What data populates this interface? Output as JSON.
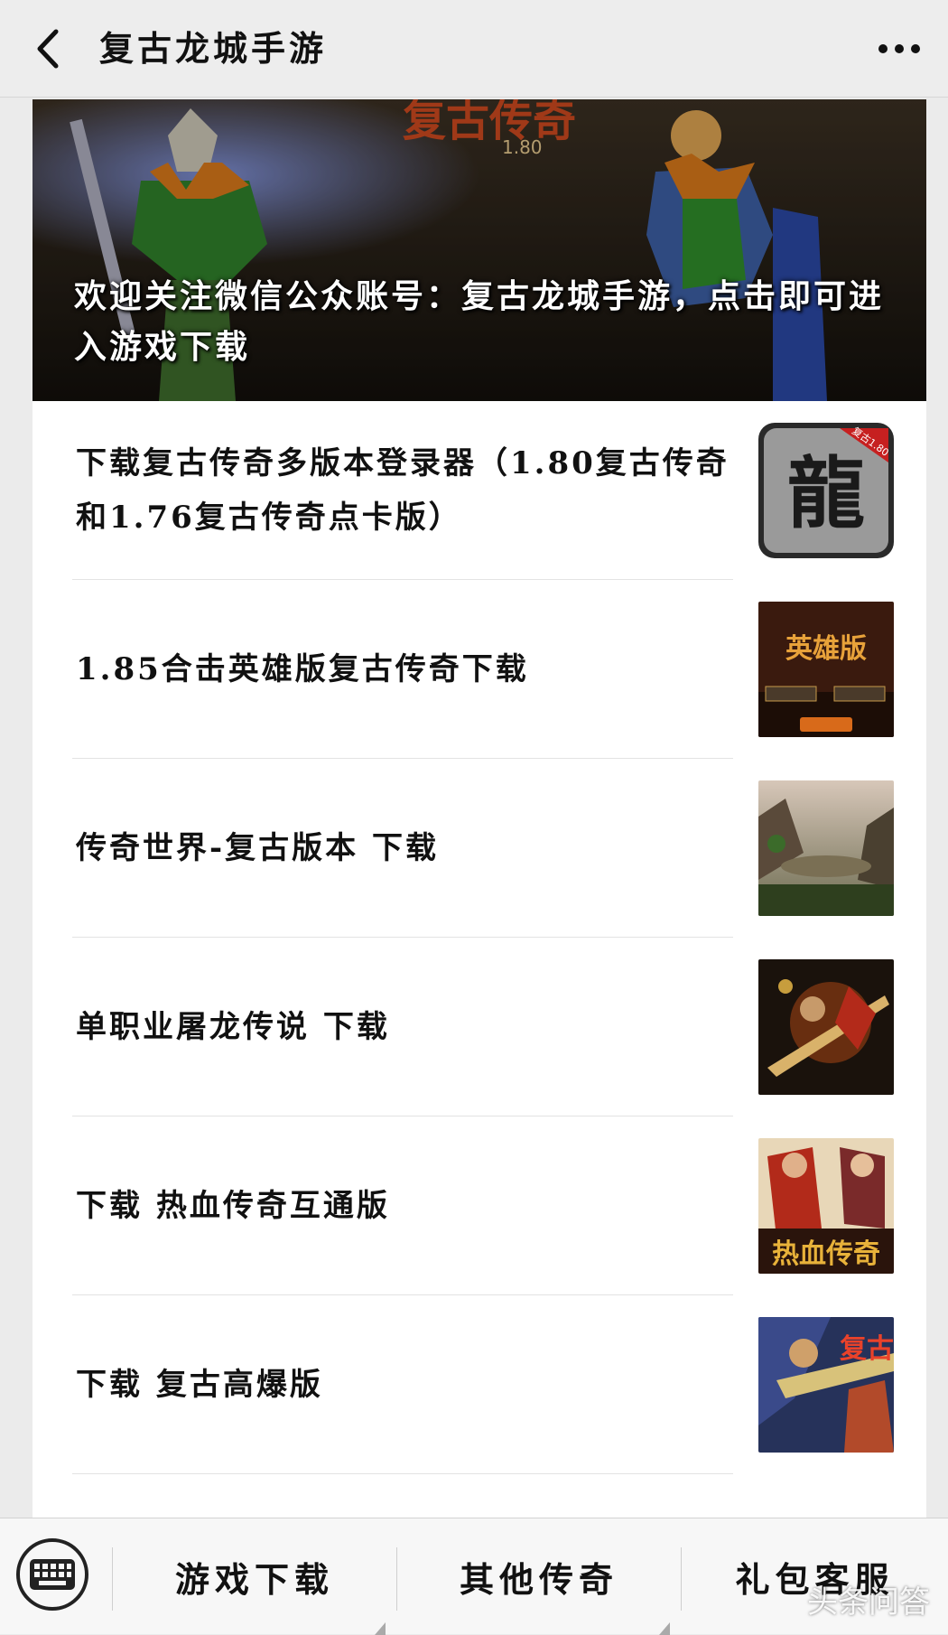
{
  "header": {
    "title": "复古龙城手游",
    "back_icon": "chevron-left-icon",
    "more_icon": "more-dots-icon"
  },
  "banner": {
    "caption": "欢迎关注微信公众账号：复古龙城手游，点击即可进入游戏下载",
    "logo_text": "复古传奇",
    "logo_version": "1.80"
  },
  "items": [
    {
      "title": "下载复古传奇多版本登录器（1.80复古传奇和1.76复古传奇点卡版）",
      "thumb_text": "龍",
      "thumb_badge": "复古1.80"
    },
    {
      "title": "1.85合击英雄版复古传奇下载",
      "thumb_text": "英雄版"
    },
    {
      "title": "传奇世界-复古版本 下载"
    },
    {
      "title": "单职业屠龙传说 下载"
    },
    {
      "title": "下载 热血传奇互通版",
      "thumb_text": "热血传奇"
    },
    {
      "title": "下载 复古高爆版",
      "thumb_text": "复古"
    }
  ],
  "menu": {
    "keyboard_icon": "keyboard-icon",
    "items": [
      {
        "label": "游戏下载"
      },
      {
        "label": "其他传奇"
      },
      {
        "label": "礼包客服"
      }
    ]
  },
  "watermark": "头条问答",
  "colors": {
    "background": "#ebebeb",
    "card": "#ffffff",
    "text": "#111111"
  }
}
